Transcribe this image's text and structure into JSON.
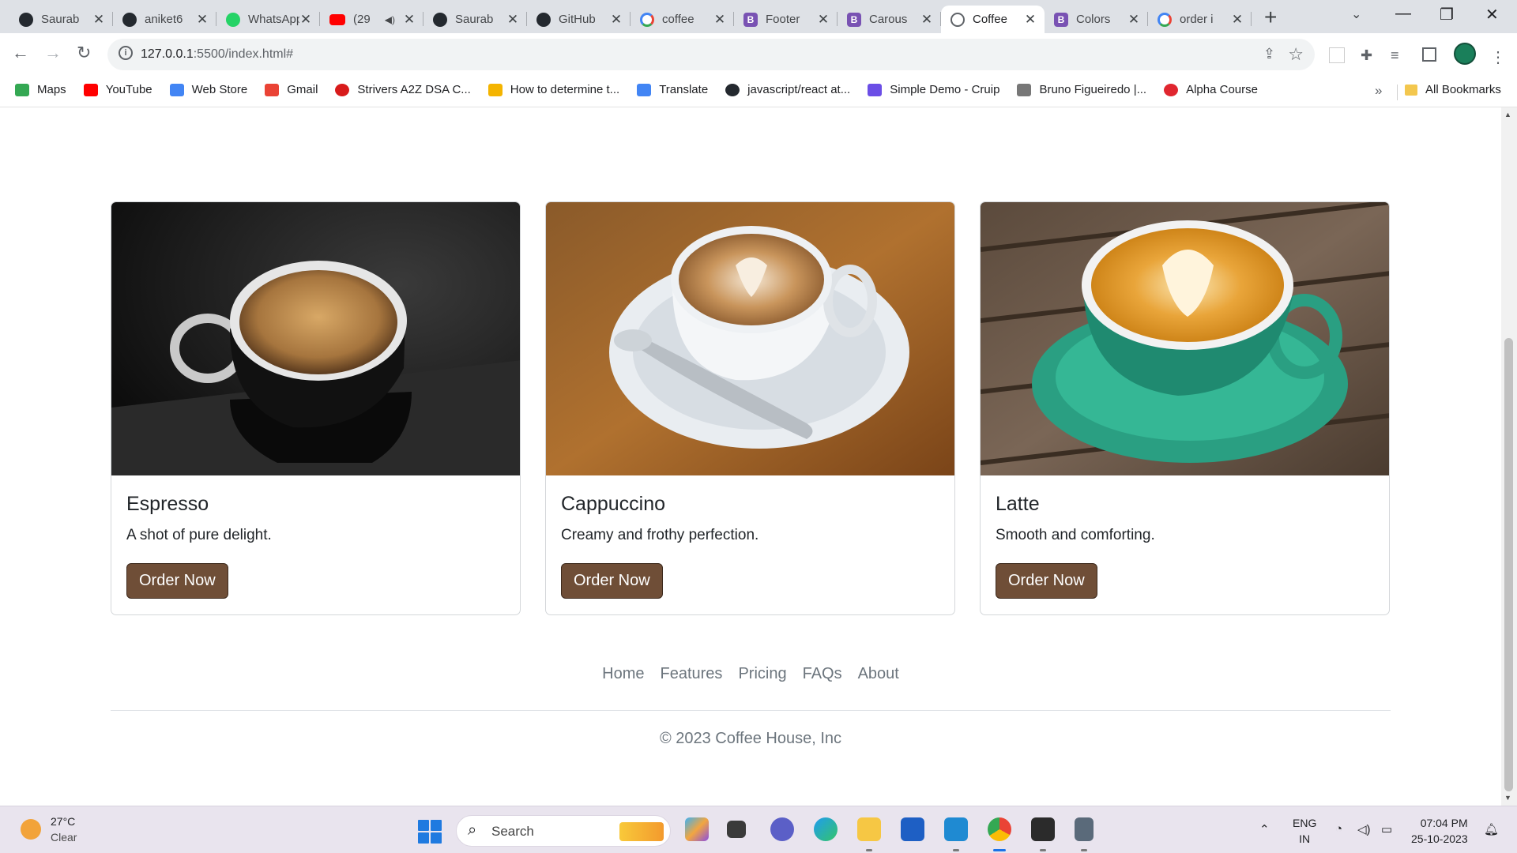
{
  "browser": {
    "tabs": [
      {
        "title": "Saurab",
        "icon": "github-icon"
      },
      {
        "title": "aniket6",
        "icon": "github-icon"
      },
      {
        "title": "WhatsApp",
        "icon": "whatsapp-icon"
      },
      {
        "title": "(29",
        "icon": "youtube-icon"
      },
      {
        "title": "Saurab",
        "icon": "github-icon"
      },
      {
        "title": "GitHub",
        "icon": "github-icon"
      },
      {
        "title": "coffee",
        "icon": "google-icon"
      },
      {
        "title": "Footer",
        "icon": "bootstrap-icon"
      },
      {
        "title": "Carous",
        "icon": "bootstrap-icon"
      },
      {
        "title": "Coffee",
        "icon": "globe-icon"
      },
      {
        "title": "Colors",
        "icon": "bootstrap-icon"
      },
      {
        "title": "order i",
        "icon": "google-icon"
      }
    ],
    "active_tab_index": 9,
    "url_host": "127.0.0.1",
    "url_rest": ":5500/index.html#",
    "bookmarks": [
      {
        "label": "Maps",
        "color": "#34a853"
      },
      {
        "label": "YouTube",
        "color": "#ff0000"
      },
      {
        "label": "Web Store",
        "color": "#4285f4"
      },
      {
        "label": "Gmail",
        "color": "#ea4335"
      },
      {
        "label": "Strivers A2Z DSA C...",
        "color": "#d81b1b"
      },
      {
        "label": "How to determine t...",
        "color": "#f4b400"
      },
      {
        "label": "Translate",
        "color": "#4285f4"
      },
      {
        "label": "javascript/react at...",
        "color": "#24292f"
      },
      {
        "label": "Simple Demo - Cruip",
        "color": "#6b4ee6"
      },
      {
        "label": "Bruno Figueiredo |...",
        "color": "#777777"
      },
      {
        "label": "Alpha Course",
        "color": "#e0262f"
      }
    ],
    "all_bookmarks_label": "All Bookmarks"
  },
  "page": {
    "cards": [
      {
        "title": "Espresso",
        "text": "A shot of pure delight.",
        "button": "Order Now"
      },
      {
        "title": "Cappuccino",
        "text": "Creamy and frothy perfection.",
        "button": "Order Now"
      },
      {
        "title": "Latte",
        "text": "Smooth and comforting.",
        "button": "Order Now"
      }
    ],
    "footer_links": [
      "Home",
      "Features",
      "Pricing",
      "FAQs",
      "About"
    ],
    "copyright": "© 2023 Coffee House, Inc",
    "colors": {
      "button": "#6f4e37",
      "footer_text": "#6c757d"
    }
  },
  "taskbar": {
    "weather_temp": "27°C",
    "weather_desc": "Clear",
    "search_placeholder": "Search",
    "lang_1": "ENG",
    "lang_2": "IN",
    "time": "07:04 PM",
    "date": "25-10-2023"
  }
}
